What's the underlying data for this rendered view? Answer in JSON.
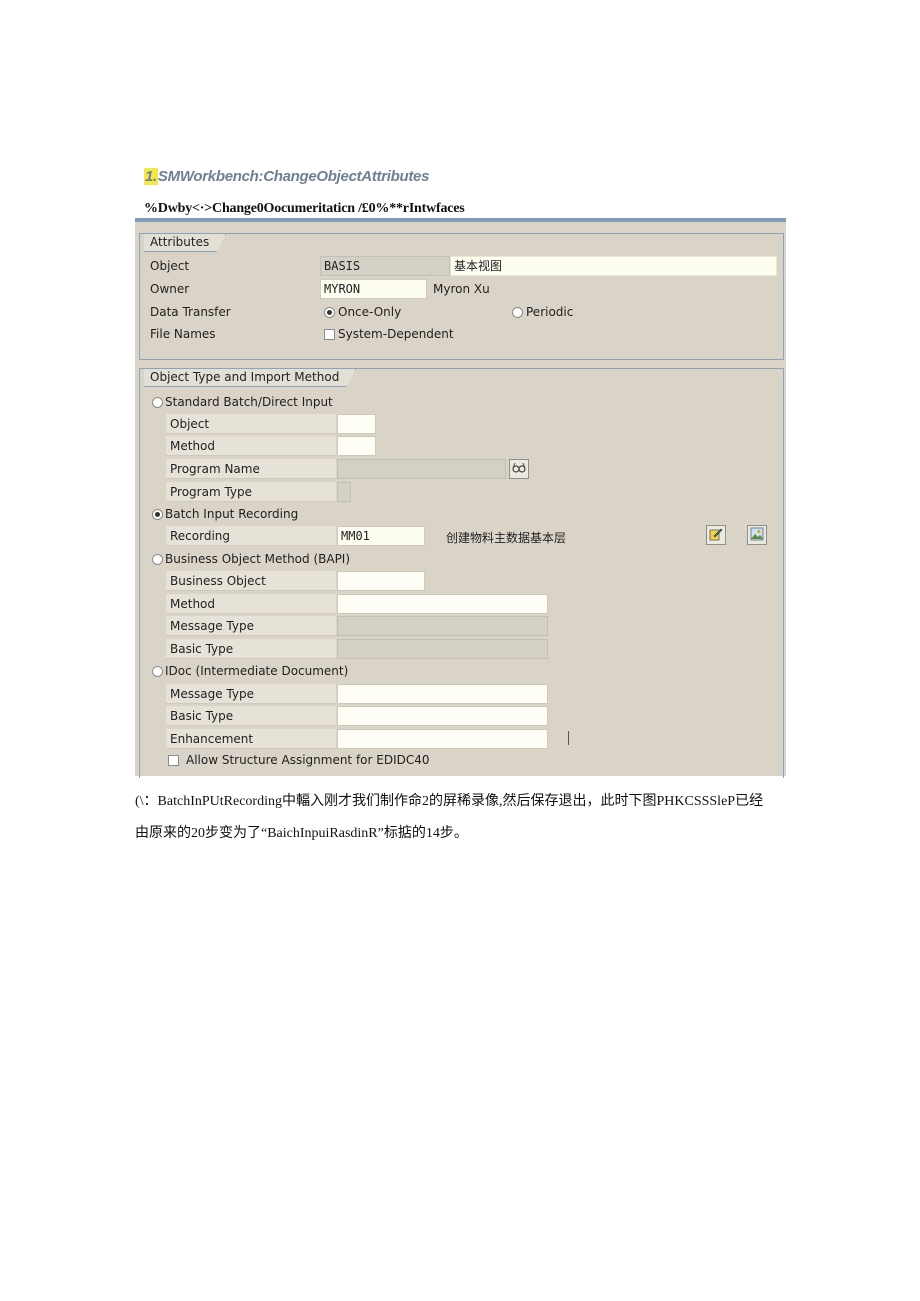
{
  "heading": {
    "number": "1.",
    "text": "SMWorkbench:ChangeObjectAttributes"
  },
  "subheading": "%Dwby<·>Change0Oocumeritaticn /£0%**rIntwfaces",
  "attributes": {
    "group_title": "Attributes",
    "object_label": "Object",
    "object_value": "BASIS",
    "object_desc": "基本视图",
    "owner_label": "Owner",
    "owner_value": "MYRON",
    "owner_name": "Myron Xu",
    "data_transfer_label": "Data Transfer",
    "once_only_label": "Once-Only",
    "periodic_label": "Periodic",
    "file_names_label": "File Names",
    "system_dependent_label": "System-Dependent"
  },
  "object_type": {
    "group_title": "Object Type and Import Method",
    "standard_batch_label": "Standard Batch/Direct Input",
    "sb_object_label": "Object",
    "sb_method_label": "Method",
    "sb_program_name_label": "Program Name",
    "sb_program_type_label": "Program Type",
    "batch_input_recording_label": "Batch Input Recording",
    "recording_label": "Recording",
    "recording_value": "MM01",
    "recording_desc": "创建物料主数据基本层",
    "bapi_label": "Business Object Method (BAPI)",
    "bapi_business_object_label": "Business Object",
    "bapi_method_label": "Method",
    "bapi_message_type_label": "Message Type",
    "bapi_basic_type_label": "Basic Type",
    "idoc_label": "IDoc (Intermediate Document)",
    "idoc_message_type_label": "Message Type",
    "idoc_basic_type_label": "Basic Type",
    "idoc_enhancement_label": "Enhancement",
    "allow_structure_label": "Allow Structure Assignment for EDIDC40"
  },
  "footer": {
    "line1": "(\\：BatchInPUtRecording中輻入刚才我们制作命2的屏稀录像,然后保存退出，此时下图PHKCSSSleP已经",
    "line2": "由原来的20步变为了“BaichInpuiRasdinR”标掂的14步。"
  },
  "colors": {
    "screen_bg": "#d9d4c7",
    "frame_blue": "#7f9db8",
    "heading_gray": "#6f7f96",
    "highlight": "#f4e74a"
  }
}
